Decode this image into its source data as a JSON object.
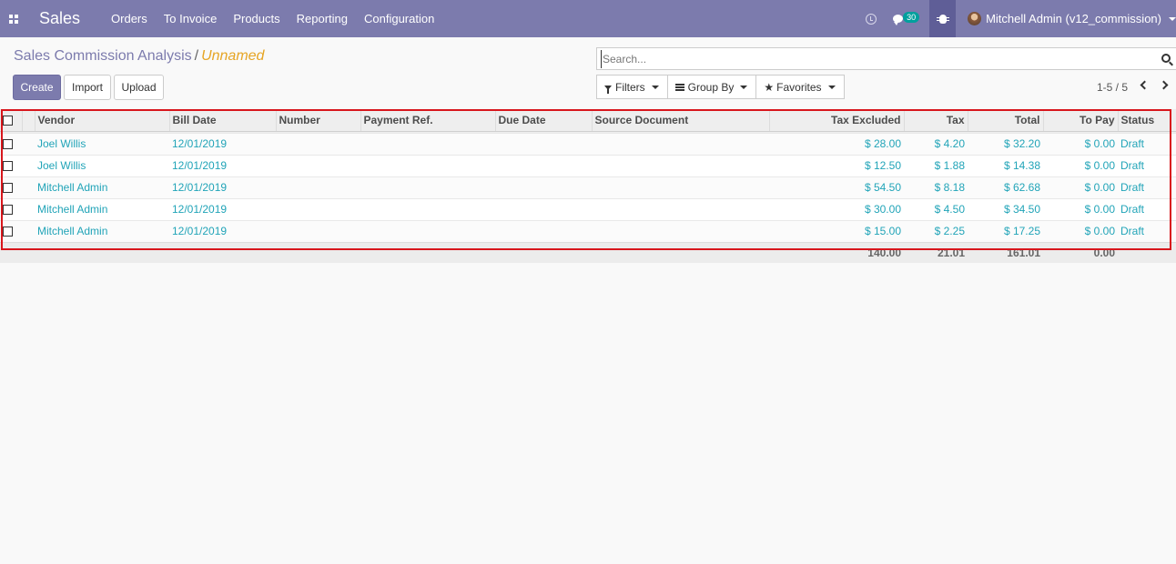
{
  "navbar": {
    "app_name": "Sales",
    "menu": [
      "Orders",
      "To Invoice",
      "Products",
      "Reporting",
      "Configuration"
    ],
    "chat_count": "30",
    "user_name": "Mitchell Admin (v12_commission)"
  },
  "breadcrumb": {
    "parent": "Sales Commission Analysis",
    "separator": "/",
    "current": "Unnamed"
  },
  "buttons": {
    "create": "Create",
    "import": "Import",
    "upload": "Upload"
  },
  "search": {
    "placeholder": "Search..."
  },
  "filters": {
    "filters_label": "Filters",
    "groupby_label": "Group By",
    "favorites_label": "Favorites"
  },
  "pager": {
    "value": "1-5 / 5"
  },
  "table": {
    "headers": {
      "vendor": "Vendor",
      "bill_date": "Bill Date",
      "number": "Number",
      "payment_ref": "Payment Ref.",
      "due_date": "Due Date",
      "source_document": "Source Document",
      "tax_excluded": "Tax Excluded",
      "tax": "Tax",
      "total": "Total",
      "to_pay": "To Pay",
      "status": "Status"
    },
    "rows": [
      {
        "vendor": "Joel Willis",
        "bill_date": "12/01/2019",
        "tax_excluded": "$ 28.00",
        "tax": "$ 4.20",
        "total": "$ 32.20",
        "to_pay": "$ 0.00",
        "status": "Draft"
      },
      {
        "vendor": "Joel Willis",
        "bill_date": "12/01/2019",
        "tax_excluded": "$ 12.50",
        "tax": "$ 1.88",
        "total": "$ 14.38",
        "to_pay": "$ 0.00",
        "status": "Draft"
      },
      {
        "vendor": "Mitchell Admin",
        "bill_date": "12/01/2019",
        "tax_excluded": "$ 54.50",
        "tax": "$ 8.18",
        "total": "$ 62.68",
        "to_pay": "$ 0.00",
        "status": "Draft"
      },
      {
        "vendor": "Mitchell Admin",
        "bill_date": "12/01/2019",
        "tax_excluded": "$ 30.00",
        "tax": "$ 4.50",
        "total": "$ 34.50",
        "to_pay": "$ 0.00",
        "status": "Draft"
      },
      {
        "vendor": "Mitchell Admin",
        "bill_date": "12/01/2019",
        "tax_excluded": "$ 15.00",
        "tax": "$ 2.25",
        "total": "$ 17.25",
        "to_pay": "$ 0.00",
        "status": "Draft"
      }
    ],
    "totals": {
      "tax_excluded": "140.00",
      "tax": "21.01",
      "total": "161.01",
      "to_pay": "0.00"
    }
  },
  "colors": {
    "navbar": "#7c7bad",
    "link": "#21a4b8",
    "highlight": "#d8161c",
    "breadcrumb_current": "#e6a525"
  }
}
